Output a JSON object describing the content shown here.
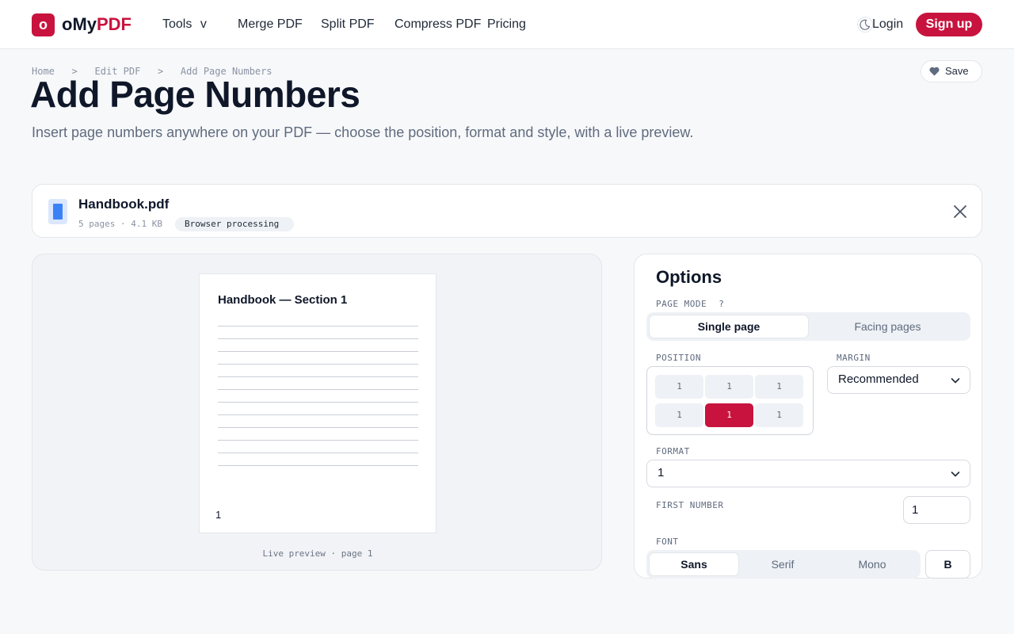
{
  "brand": {
    "logo_letter": "o",
    "name_prefix": "oMy",
    "name_accent": "PDF",
    "accent_color": "#c8133e"
  },
  "nav": {
    "tools": "Tools",
    "tools_chevron": "v",
    "merge": "Merge PDF",
    "split": "Split PDF",
    "compress": "Compress PDF",
    "pricing": "Pricing",
    "login": "Login",
    "signup": "Sign up"
  },
  "breadcrumb": {
    "home": "Home",
    "sep": ">",
    "edit": "Edit PDF",
    "current": "Add Page Numbers"
  },
  "save_label": "Save",
  "page": {
    "title": "Add Page Numbers",
    "subtitle": "Insert page numbers anywhere on your PDF — choose the position, format and style, with a live preview."
  },
  "file": {
    "name": "Handbook.pdf",
    "meta": "5 pages · 4.1 KB",
    "badge": "Browser processing"
  },
  "preview": {
    "heading": "Handbook — Section 1",
    "number": "1",
    "caption": "Live preview · page 1"
  },
  "options": {
    "title": "Options",
    "page_mode_label": "PAGE MODE",
    "page_mode_help": "?",
    "page_mode_options": [
      "Single page",
      "Facing pages"
    ],
    "page_mode_selected": "Single page",
    "position_label": "POSITION",
    "position_cells": [
      "1",
      "1",
      "1",
      "1",
      "1",
      "1"
    ],
    "position_selected": "bottom-center",
    "margin_label": "MARGIN",
    "margin_value": "Recommended",
    "format_label": "FORMAT",
    "format_value": "1",
    "first_number_label": "FIRST NUMBER",
    "first_number_value": "1",
    "font_label": "FONT",
    "font_options": [
      "Sans",
      "Serif",
      "Mono"
    ],
    "font_selected": "Sans",
    "bold_label": "B"
  }
}
